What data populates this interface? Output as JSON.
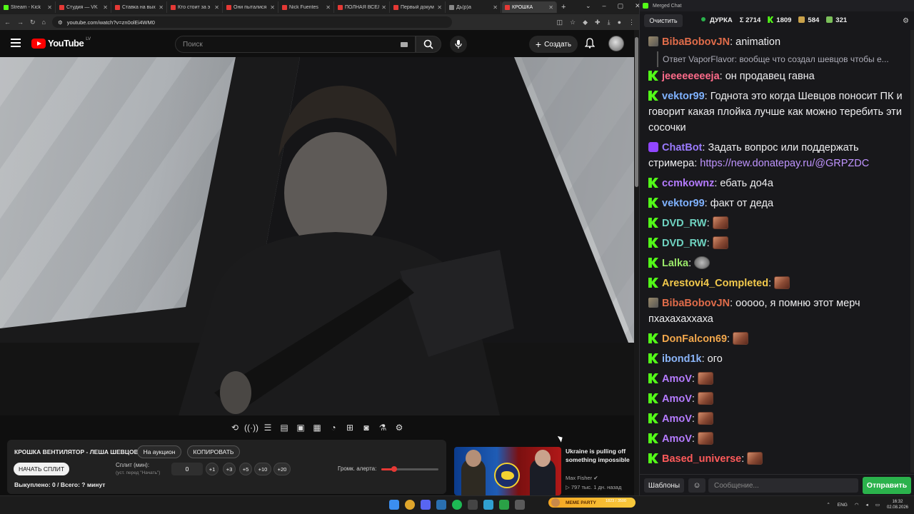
{
  "browser": {
    "tabs": [
      {
        "label": "Stream - Kick",
        "color": "#53fc18"
      },
      {
        "label": "Студия — VK",
        "color": "#e53935"
      },
      {
        "label": "Ставка на вых",
        "color": "#e53935"
      },
      {
        "label": "Кто стоит за э",
        "color": "#e53935"
      },
      {
        "label": "Они пыталися",
        "color": "#e53935"
      },
      {
        "label": "Nick Fuentes",
        "color": "#e53935"
      },
      {
        "label": "ПОЛНАЯ ВСЕЛ",
        "color": "#e53935"
      },
      {
        "label": "Первый докум",
        "color": "#e53935"
      },
      {
        "label": "Дь(р)а",
        "color": "#888888"
      },
      {
        "label": "КРОШКА",
        "color": "#e53935"
      }
    ],
    "url": "youtube.com/watch?v=zn0olEi4WM0"
  },
  "youtube": {
    "logo_text": "YouTube",
    "country_code": "LV",
    "search_placeholder": "Поиск",
    "create_label": "Создать"
  },
  "panel": {
    "title": "КРОШКА ВЕНТИЛЯТОР - ЛЕША ШЕВЦОВ",
    "auction_label": "На аукцион",
    "copy_label": "КОПИРОВАТЬ",
    "start_split_label": "НАЧАТЬ СПЛИТ",
    "split_label": "Сплит (мин):",
    "split_hint": "(уст. перед \"Начать\")",
    "split_value": "0",
    "increments": [
      "+1",
      "+3",
      "+5",
      "+10",
      "+20"
    ],
    "volume_label": "Громк. алерта:",
    "volume_level": 0.22,
    "bought_text": "Выкуплено: 0 / Всего: ? минут"
  },
  "recommended": {
    "title": "Ukraine is pulling off something impossible",
    "channel": "Max Fisher",
    "meta": "▷ 797 тыс.   1 дн. назад"
  },
  "chat": {
    "window_title": "Merged Chat",
    "clear_label": "Очистить",
    "streamer": "ДУРКА",
    "count_total": "Σ 2714",
    "count_kick": "1809",
    "count_twitch": "584",
    "count_other": "321",
    "messages": [
      {
        "badge": "twitch",
        "name": "BibaBobovJN",
        "color": "#e06c4a",
        "text": "animation",
        "emotes": 0
      },
      {
        "badge": "kick",
        "name": "jeeeeeeeeja",
        "color": "#ff6b8a",
        "text": "он продавец гавна",
        "emotes": 0,
        "reply": "Ответ VaporFlavor: вообще что создал шевцов чтобы е..."
      },
      {
        "badge": "kick",
        "name": "vektor99",
        "color": "#7fb2ff",
        "text": "Годнота это когда Шевцов поносит ПК и говорит какая плойка лучше как можно теребить эти сосочки",
        "emotes": 0
      },
      {
        "badge": "bot",
        "name": "ChatBot",
        "color": "#9b7bff",
        "text": "Задать вопрос или поддержать стримера: ",
        "link": "https://new.donatepay.ru/@GRPZDC",
        "emotes": 0
      },
      {
        "badge": "kick",
        "name": "ccmkownz",
        "color": "#b57bff",
        "text": "ебать до4а",
        "emotes": 0
      },
      {
        "badge": "kick",
        "name": "vektor99",
        "color": "#7fb2ff",
        "text": "факт от деда",
        "emotes": 0
      },
      {
        "badge": "kick",
        "name": "DVD_RW",
        "color": "#6fd3c1",
        "text": "",
        "emotes": 1
      },
      {
        "badge": "kick",
        "name": "DVD_RW",
        "color": "#6fd3c1",
        "text": "",
        "emotes": 1
      },
      {
        "badge": "kick",
        "name": "Lalka",
        "color": "#9be86a",
        "text": "",
        "emotes": 1,
        "grey": true
      },
      {
        "badge": "kick",
        "name": "Arestovi4_Completed",
        "color": "#f2c94c",
        "text": "",
        "emotes": 1
      },
      {
        "badge": "twitch",
        "name": "BibaBobovJN",
        "color": "#e06c4a",
        "text": "ооооо, я помню этот мерч пхахахаххаха",
        "emotes": 0
      },
      {
        "badge": "kick",
        "name": "DonFalcon69",
        "color": "#f2a74c",
        "text": "",
        "emotes": 1
      },
      {
        "badge": "kick",
        "name": "ibond1k",
        "color": "#8ab4f8",
        "text": "ого",
        "emotes": 0
      },
      {
        "badge": "kick",
        "name": "AmoV",
        "color": "#b57bff",
        "text": "",
        "emotes": 1
      },
      {
        "badge": "kick",
        "name": "AmoV",
        "color": "#b57bff",
        "text": "",
        "emotes": 1
      },
      {
        "badge": "kick",
        "name": "AmoV",
        "color": "#b57bff",
        "text": "",
        "emotes": 1
      },
      {
        "badge": "kick",
        "name": "AmoV",
        "color": "#b57bff",
        "text": "",
        "emotes": 1
      },
      {
        "badge": "kick",
        "name": "Based_universe",
        "color": "#ff5a5a",
        "text": "",
        "emotes": 1
      }
    ],
    "templates_label": "Шаблоны",
    "input_placeholder": "Сообщение...",
    "send_label": "Отправить"
  },
  "taskbar": {
    "widget_text": "MEME PARTY",
    "widget_sub": "1823 / 3500",
    "lang": "ENG",
    "time": "16:32",
    "date": "02.08.2026"
  }
}
